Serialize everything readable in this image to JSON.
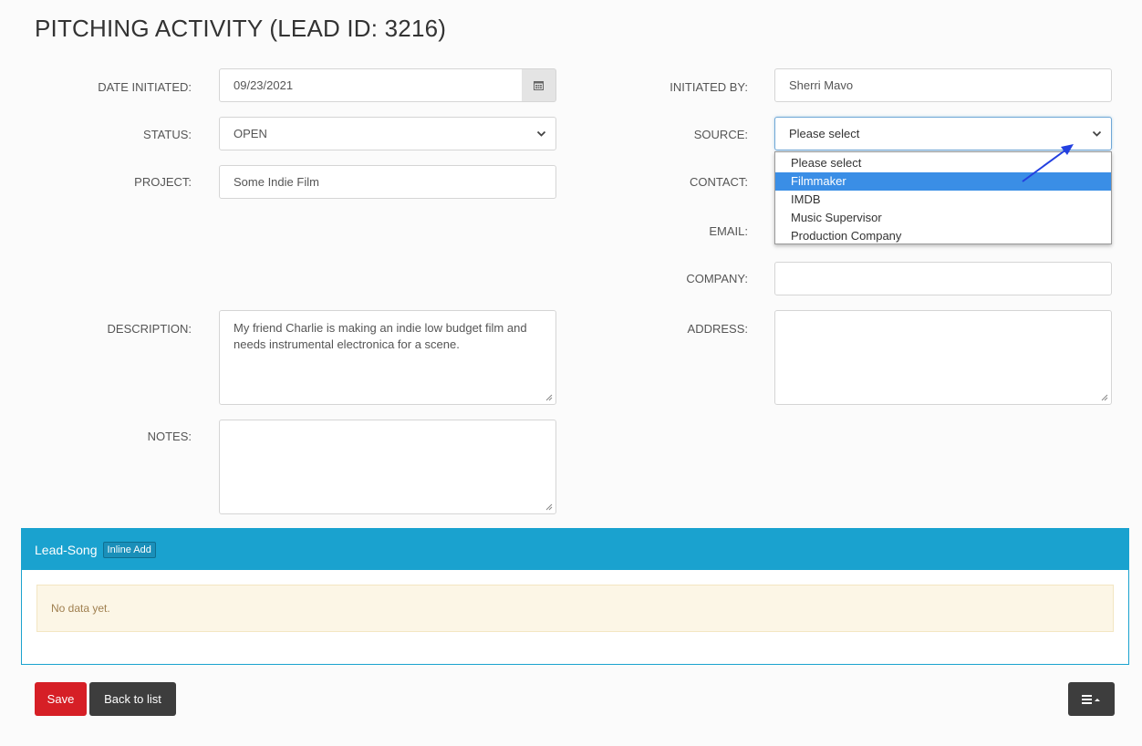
{
  "page": {
    "title": "PITCHING ACTIVITY (LEAD ID: 3216)"
  },
  "left": {
    "date_label": "DATE INITIATED:",
    "date_value": "09/23/2021",
    "status_label": "STATUS:",
    "status_value": "OPEN",
    "project_label": "PROJECT:",
    "project_value": "Some Indie Film",
    "description_label": "DESCRIPTION:",
    "description_value": "My friend Charlie is making an indie low budget film and needs instrumental electronica for a scene.",
    "notes_label": "NOTES:",
    "notes_value": ""
  },
  "right": {
    "initiated_label": "INITIATED BY:",
    "initiated_value": "Sherri Mavo",
    "source_label": "SOURCE:",
    "source_value": "Please select",
    "contact_label": "CONTACT:",
    "email_label": "EMAIL:",
    "company_label": "COMPANY:",
    "company_value": "",
    "address_label": "ADDRESS:",
    "address_value": ""
  },
  "source_dropdown": {
    "options": [
      "Please select",
      "Filmmaker",
      "IMDB",
      "Music Supervisor",
      "Production Company"
    ],
    "highlighted": "Filmmaker"
  },
  "panel": {
    "title": "Lead-Song",
    "inline_add": "Inline Add",
    "empty_text": "No data yet."
  },
  "actions": {
    "save": "Save",
    "back": "Back to list"
  },
  "colors": {
    "panel": "#1aa2cf",
    "save": "#d61f26",
    "dark_button": "#3d3d3d",
    "highlight": "#3a8ee6",
    "annotation_arrow": "#2340e0"
  },
  "icons": {
    "date_addon": "calendar-icon",
    "select": "chevron-down-icon",
    "menu": "hamburger-menu-icon",
    "annotation": "arrow-annotation"
  }
}
